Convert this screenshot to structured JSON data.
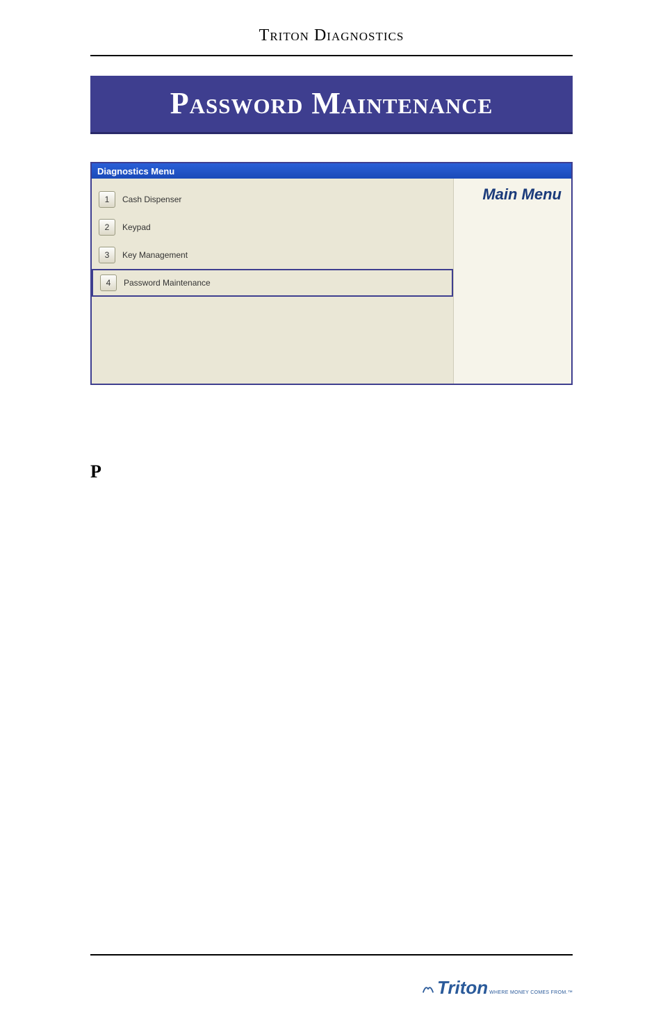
{
  "document": {
    "header_title": "Triton Diagnostics",
    "banner_title": "Password Maintenance",
    "body_letter": "P"
  },
  "window": {
    "title": "Diagnostics Menu",
    "main_menu_label": "Main Menu",
    "items": [
      {
        "num": "1",
        "label": "Cash Dispenser",
        "selected": false
      },
      {
        "num": "2",
        "label": "Keypad",
        "selected": false
      },
      {
        "num": "3",
        "label": "Key Management",
        "selected": false
      },
      {
        "num": "4",
        "label": "Password Maintenance",
        "selected": true
      }
    ]
  },
  "footer": {
    "logo_text": "Triton",
    "logo_tagline": "WHERE MONEY COMES FROM.™"
  }
}
